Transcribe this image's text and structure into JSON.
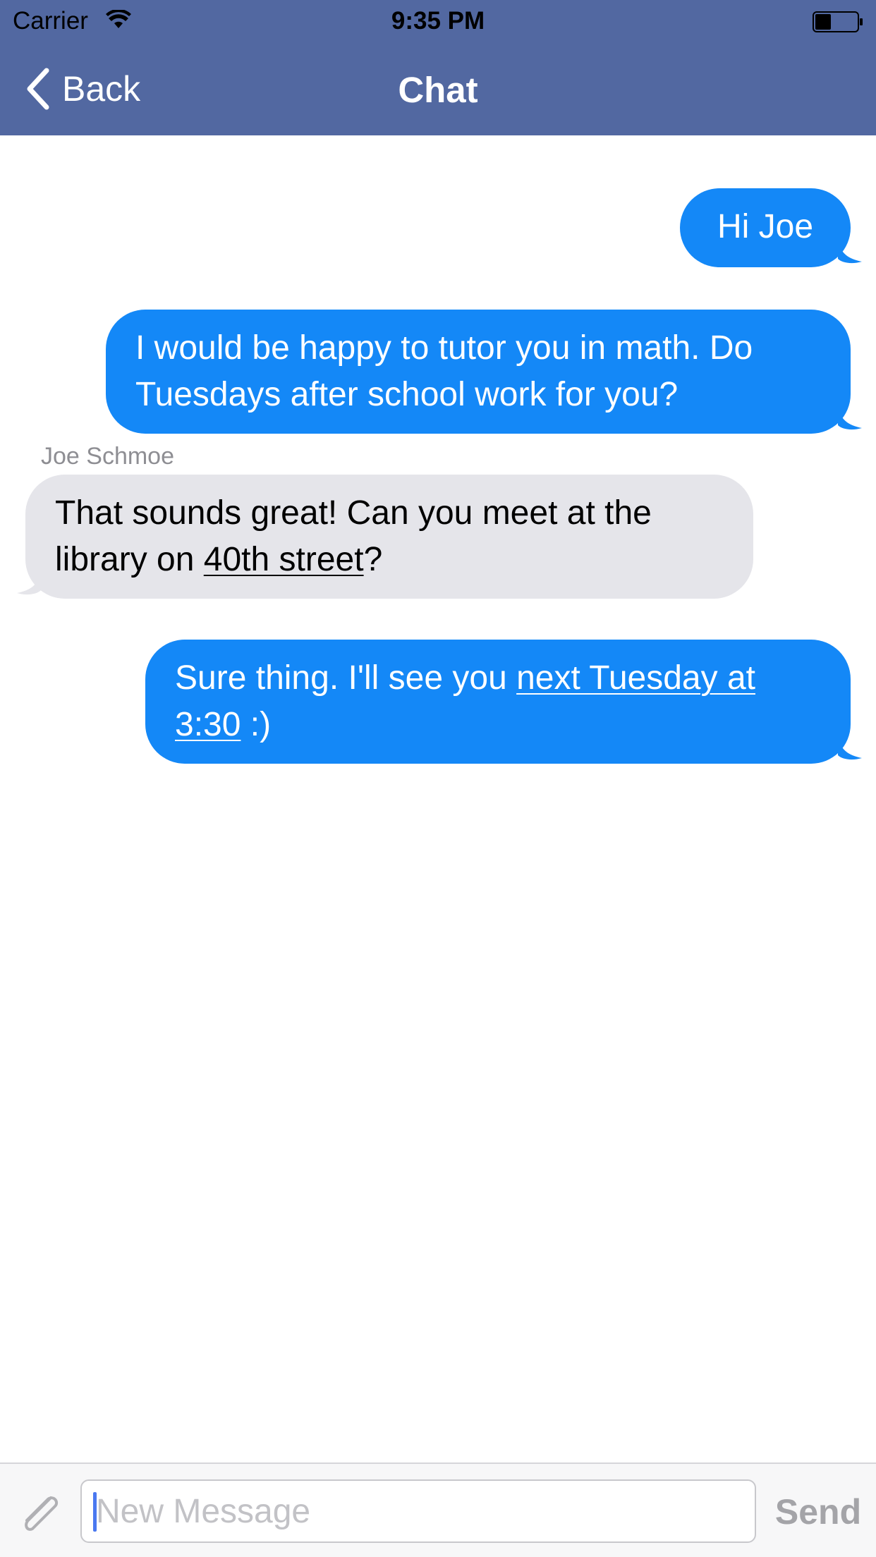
{
  "status_bar": {
    "carrier": "Carrier",
    "time": "9:35 PM"
  },
  "nav": {
    "back_label": "Back",
    "title": "Chat"
  },
  "messages": [
    {
      "direction": "outgoing",
      "text": "Hi Joe"
    },
    {
      "direction": "outgoing",
      "text": "I would be happy to tutor you in math.  Do Tuesdays after school work for you?"
    },
    {
      "direction": "incoming",
      "sender": "Joe Schmoe",
      "text_before": "That sounds great!  Can you meet at the library on ",
      "link": "40th street",
      "text_after": "?"
    },
    {
      "direction": "outgoing",
      "text_before": "Sure thing.  I'll see you ",
      "link": "next Tuesday at 3:30",
      "text_after": " :)"
    }
  ],
  "composer": {
    "placeholder": "New Message",
    "value": "",
    "send_label": "Send"
  },
  "colors": {
    "nav_bar": "#5268a1",
    "outgoing_bubble": "#1488f7",
    "incoming_bubble": "#e5e5ea",
    "send_disabled": "#a4a4a8"
  }
}
